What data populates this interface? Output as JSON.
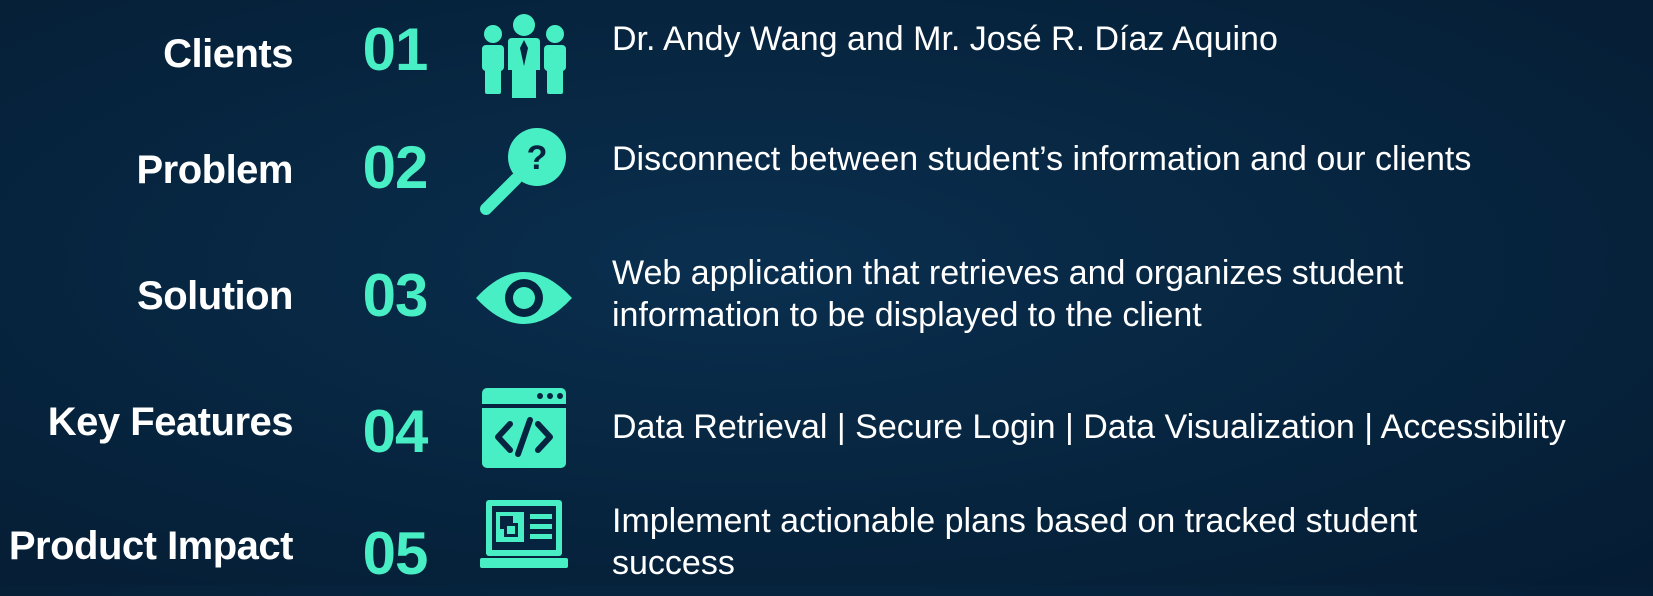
{
  "colors": {
    "accent": "#48efc4",
    "text": "#ffffff",
    "background": "#062340"
  },
  "rows": [
    {
      "label": "Clients",
      "number": "01",
      "icon": "group-icon",
      "description": "Dr. Andy Wang and Mr. José R. Díaz Aquino"
    },
    {
      "label": "Problem",
      "number": "02",
      "icon": "magnifier-question-icon",
      "description": "Disconnect between student’s information and our clients"
    },
    {
      "label": "Solution",
      "number": "03",
      "icon": "eye-icon",
      "description": "Web application that retrieves and organizes student information to be displayed to the client"
    },
    {
      "label": "Key Features",
      "number": "04",
      "icon": "code-window-icon",
      "description": "Data Retrieval | Secure Login | Data Visualization | Accessibility"
    },
    {
      "label": "Product Impact",
      "number": "05",
      "icon": "laptop-dashboard-icon",
      "description": "Implement actionable plans based on tracked student success"
    }
  ]
}
